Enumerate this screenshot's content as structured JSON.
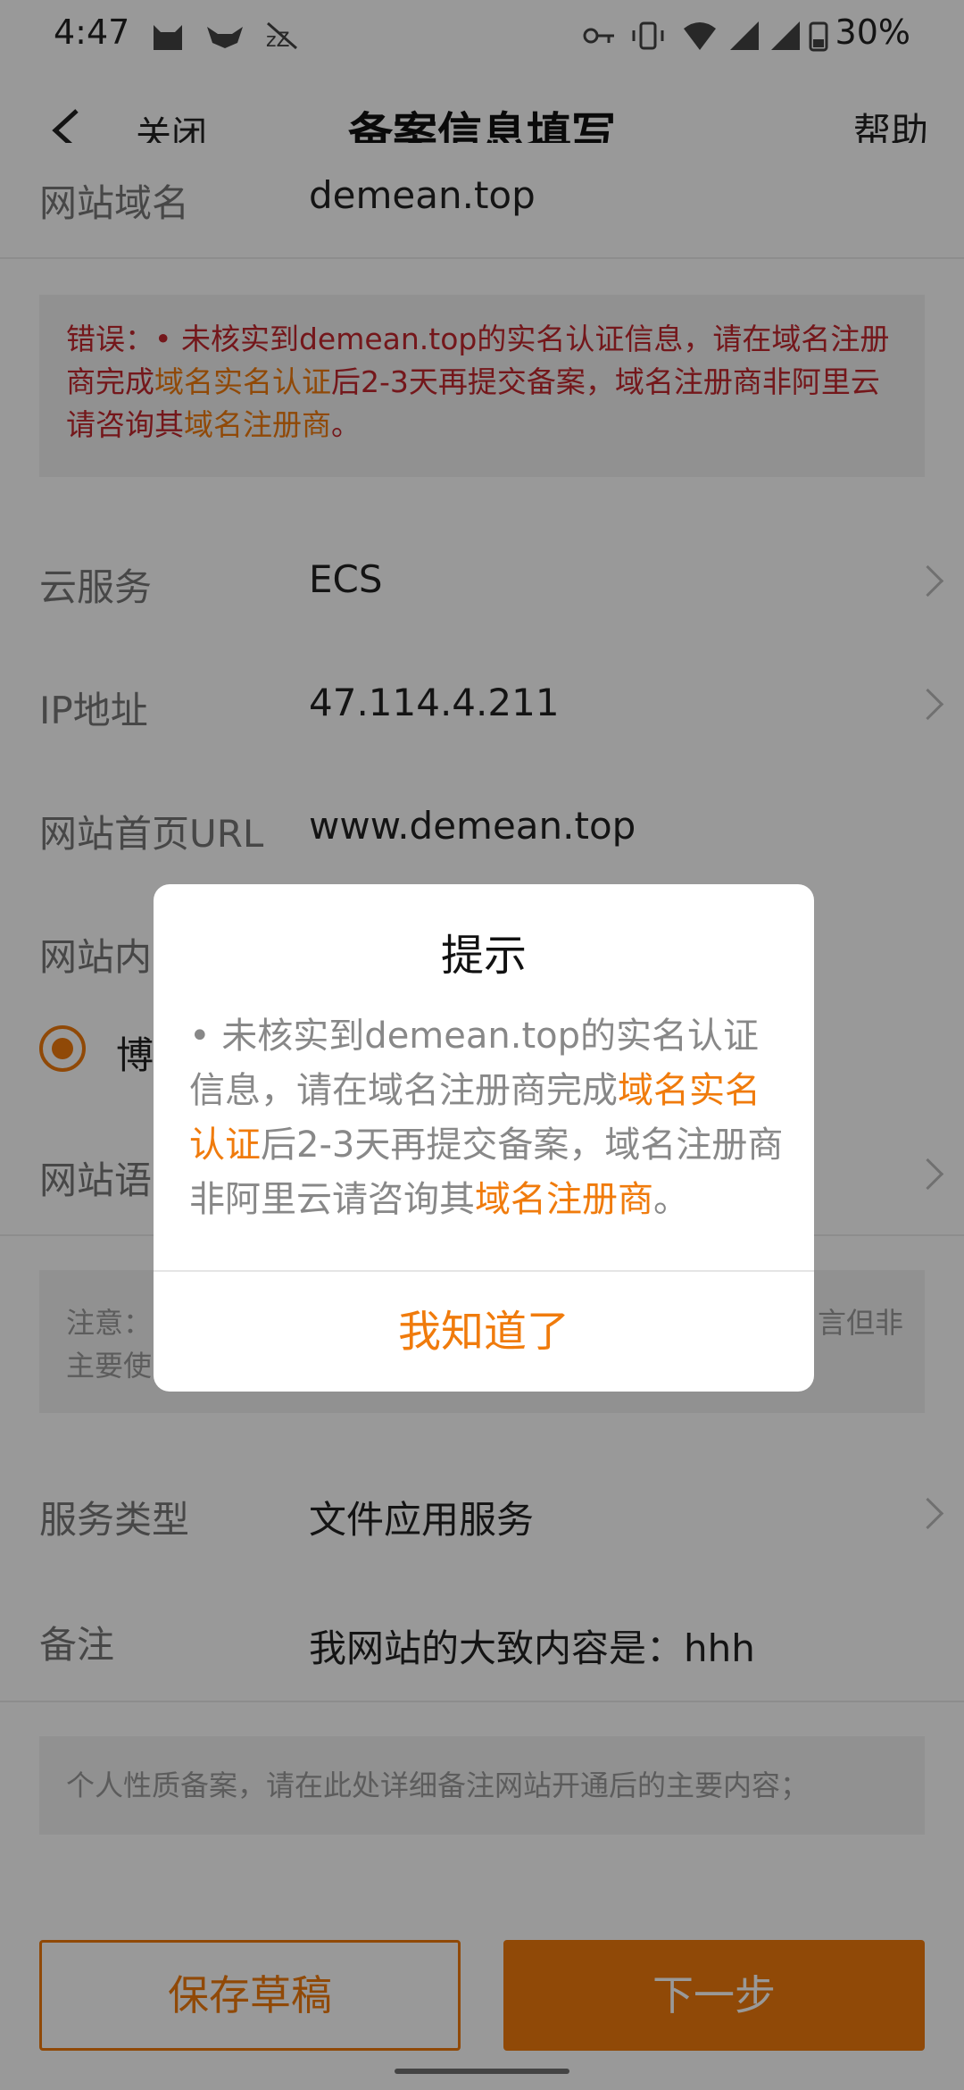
{
  "status_bar": {
    "time": "4:47",
    "battery": "30%"
  },
  "nav": {
    "close": "关闭",
    "title": "备案信息填写",
    "help": "帮助"
  },
  "form": {
    "domain": {
      "label": "网站域名",
      "value": "demean.top"
    },
    "error": {
      "prefix": "错误：",
      "bullet": "•",
      "part1": " 未核实到demean.top的实名认证信息，请在域名注册商完成",
      "link1": "域名实名认证",
      "part2": "后2-3天再提交备案，域名注册商非阿里云请咨询其",
      "link2": "域名注册商",
      "end": "。"
    },
    "cloud_service": {
      "label": "云服务",
      "value": "ECS"
    },
    "ip": {
      "label": "IP地址",
      "value": "47.114.4.211"
    },
    "homepage": {
      "label": "网站首页URL",
      "value": "www.demean.top"
    },
    "content_type": {
      "label": "网站内",
      "option": "博"
    },
    "language": {
      "label": "网站语"
    },
    "note": {
      "line1_left": "注意：",
      "line1_right": "言但非",
      "line2": "主要使"
    },
    "service_type": {
      "label": "服务类型",
      "value": "文件应用服务"
    },
    "remark": {
      "label": "备注",
      "value": "我网站的大致内容是：hhh"
    },
    "remark_hint": "个人性质备案，请在此处详细备注网站开通后的主要内容；"
  },
  "buttons": {
    "save_draft": "保存草稿",
    "next": "下一步"
  },
  "dialog": {
    "title": "提示",
    "bullet": "•",
    "part1": " 未核实到demean.top的实名认证信息，请在域名注册商完成",
    "link1": "域名实名认证",
    "part2": "后2-3天再提交备案，域名注册商非阿里云请咨询其",
    "link2": "域名注册商",
    "end": "。",
    "confirm": "我知道了"
  },
  "colors": {
    "accent": "#f07b0c",
    "error": "#c1272d"
  },
  "icons": [
    "back-arrow-icon",
    "cat-icon",
    "fox-icon",
    "sleep-icon",
    "key-icon",
    "vibrate-icon",
    "wifi-icon",
    "signal-icon",
    "battery-icon",
    "chevron-right-icon"
  ]
}
